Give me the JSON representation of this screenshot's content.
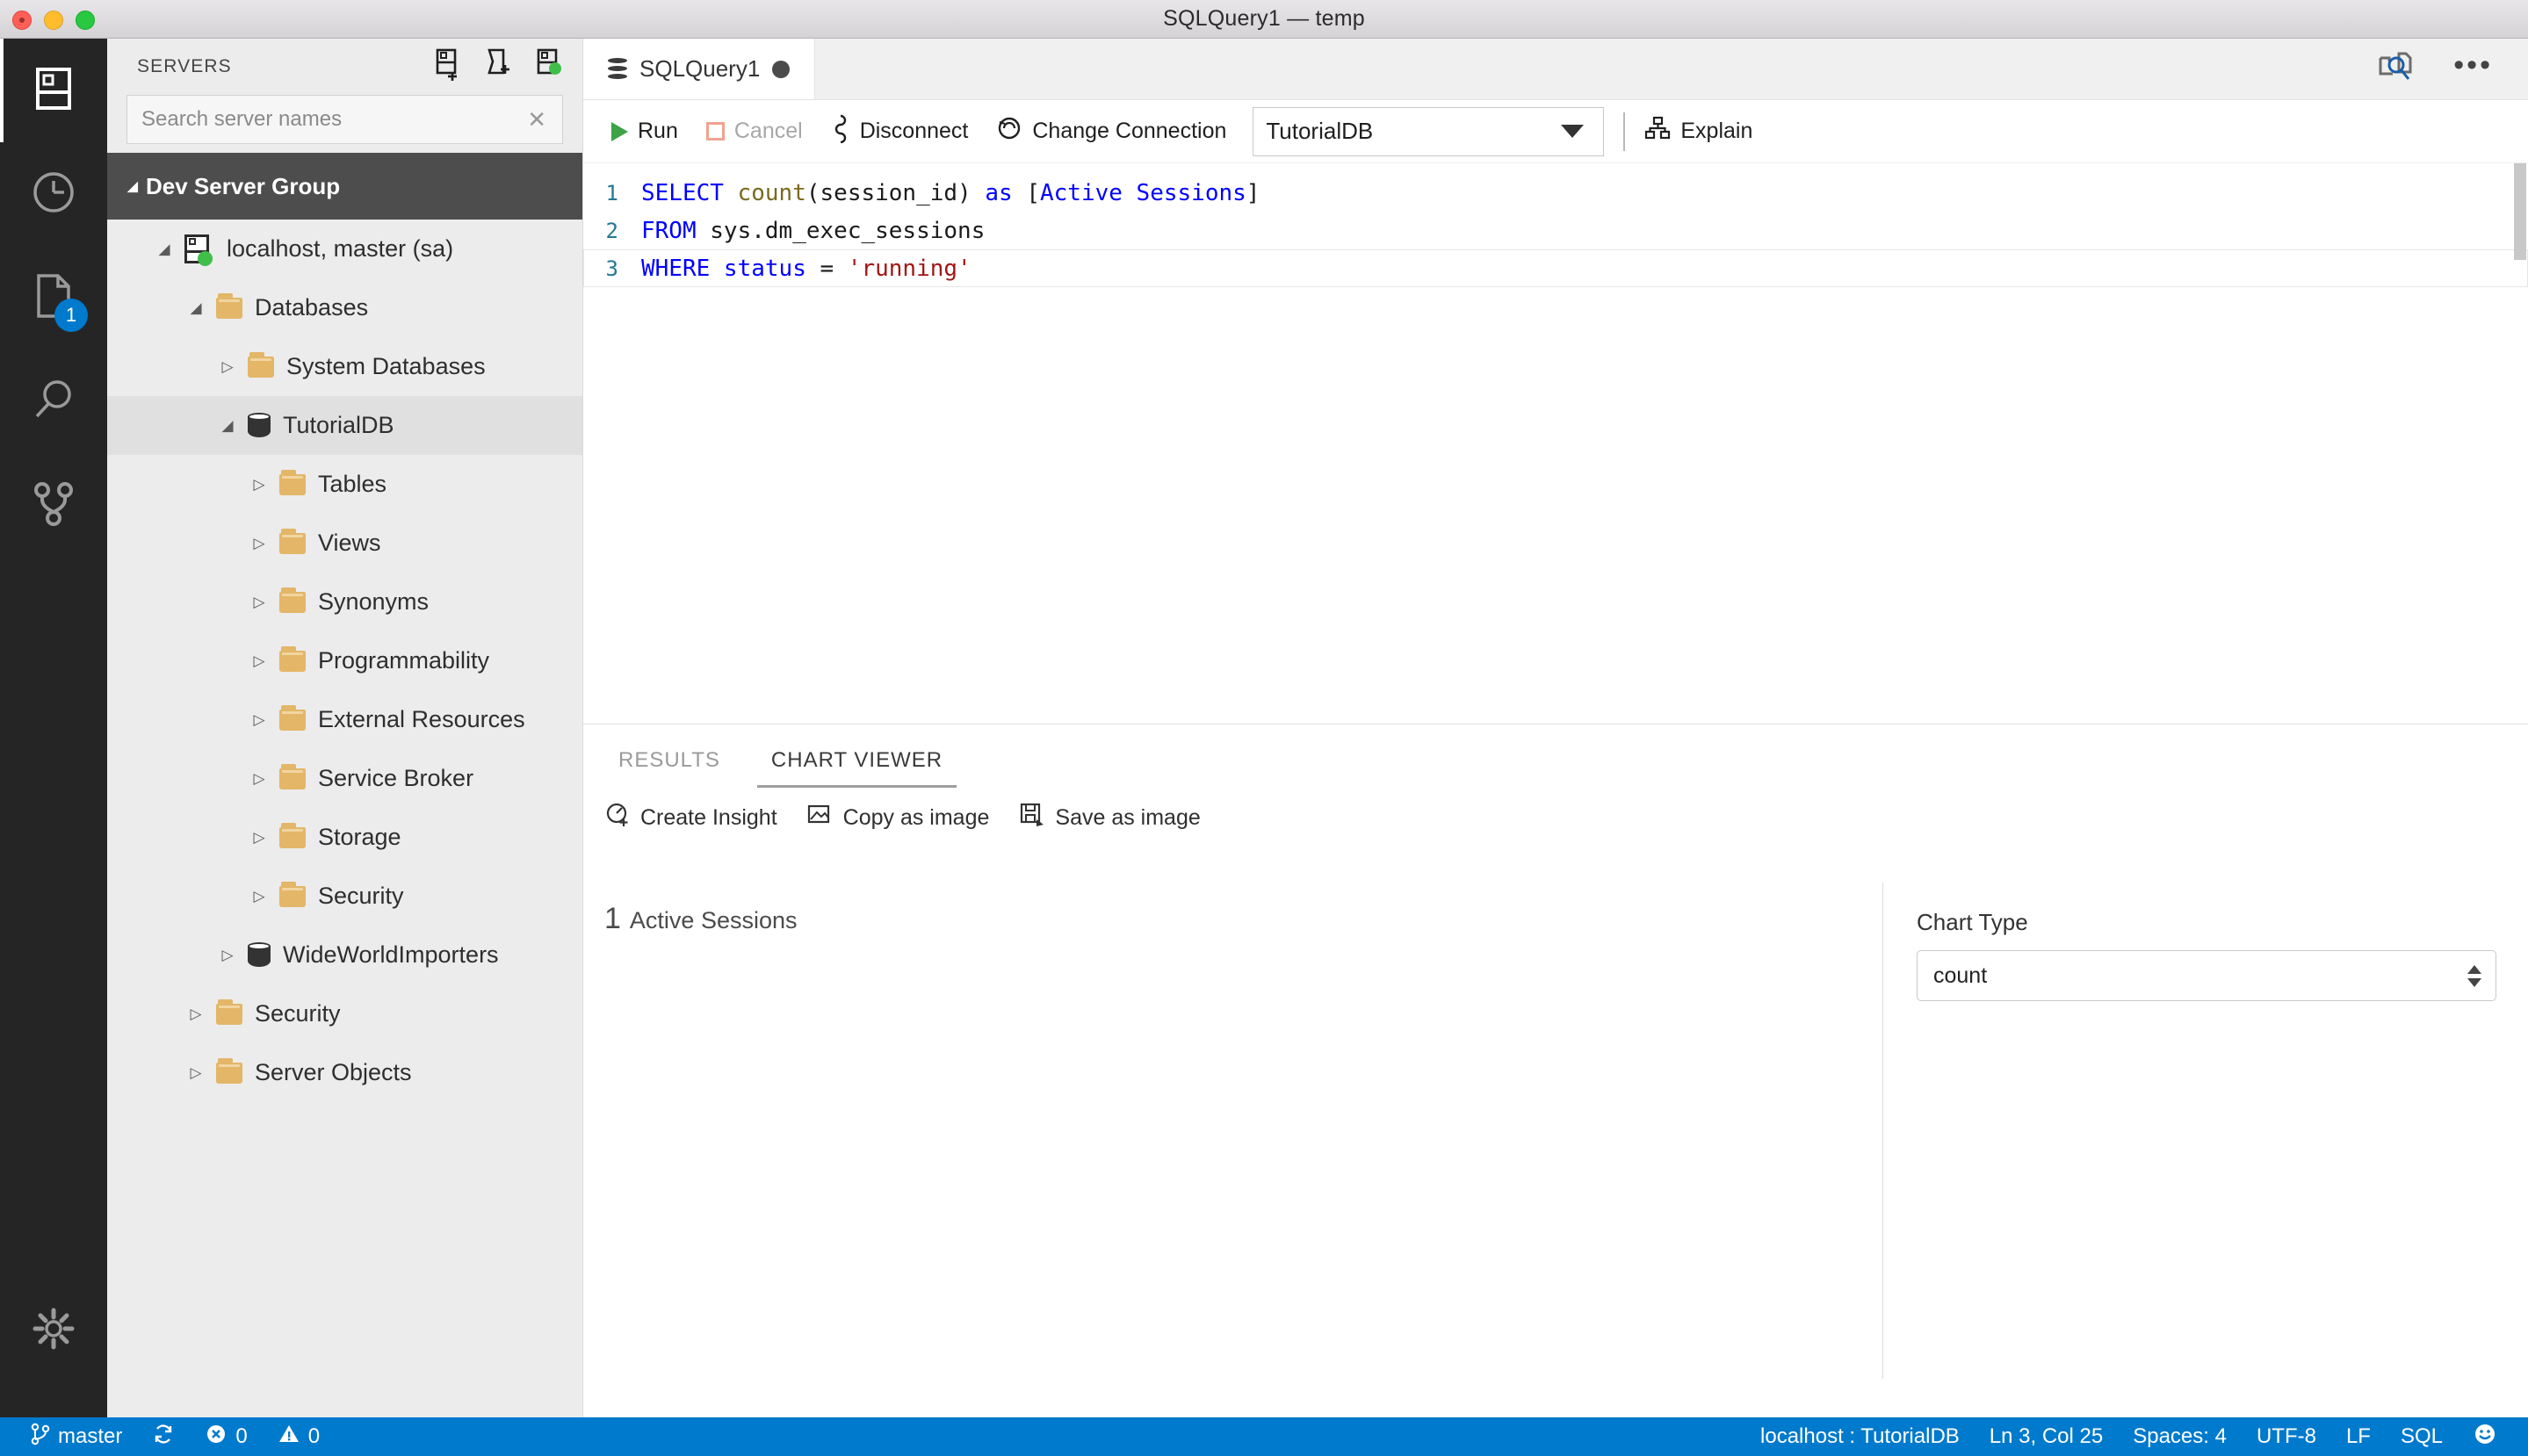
{
  "window": {
    "title": "SQLQuery1 — temp",
    "traffic_lights": [
      "close",
      "minimize",
      "zoom"
    ]
  },
  "activity_bar": {
    "items": [
      {
        "name": "servers-icon",
        "label": "Servers",
        "active": true,
        "badge": null
      },
      {
        "name": "history-icon",
        "label": "History",
        "active": false,
        "badge": null
      },
      {
        "name": "tasks-icon",
        "label": "Tasks",
        "active": false,
        "badge": "1"
      },
      {
        "name": "search-icon",
        "label": "Search",
        "active": false,
        "badge": null
      },
      {
        "name": "source-control-icon",
        "label": "Source Control",
        "active": false,
        "badge": null
      }
    ],
    "bottom": {
      "name": "gear-icon",
      "label": "Manage"
    }
  },
  "sidebar": {
    "title": "SERVERS",
    "actions": [
      {
        "name": "new-connection-icon",
        "label": "New Connection"
      },
      {
        "name": "new-server-group-icon",
        "label": "New Server Group"
      },
      {
        "name": "active-connections-icon",
        "label": "Show Active Connections"
      }
    ],
    "search": {
      "placeholder": "Search server names",
      "value": "",
      "clear_label": "✕"
    },
    "tree": [
      {
        "label": "Dev Server Group",
        "icon": "none",
        "indent": 0,
        "twisty": "expanded",
        "kind": "group",
        "selected": false
      },
      {
        "label": "localhost, master (sa)",
        "icon": "server",
        "indent": 1,
        "twisty": "expanded",
        "kind": "server",
        "selected": false
      },
      {
        "label": "Databases",
        "icon": "folder",
        "indent": 2,
        "twisty": "expanded",
        "kind": "folder",
        "selected": false
      },
      {
        "label": "System Databases",
        "icon": "folder",
        "indent": 3,
        "twisty": "collapsed",
        "kind": "folder",
        "selected": false
      },
      {
        "label": "TutorialDB",
        "icon": "database",
        "indent": 3,
        "twisty": "expanded",
        "kind": "database",
        "selected": true
      },
      {
        "label": "Tables",
        "icon": "folder",
        "indent": 4,
        "twisty": "collapsed",
        "kind": "folder",
        "selected": false
      },
      {
        "label": "Views",
        "icon": "folder",
        "indent": 4,
        "twisty": "collapsed",
        "kind": "folder",
        "selected": false
      },
      {
        "label": "Synonyms",
        "icon": "folder",
        "indent": 4,
        "twisty": "collapsed",
        "kind": "folder",
        "selected": false
      },
      {
        "label": "Programmability",
        "icon": "folder",
        "indent": 4,
        "twisty": "collapsed",
        "kind": "folder",
        "selected": false
      },
      {
        "label": "External Resources",
        "icon": "folder",
        "indent": 4,
        "twisty": "collapsed",
        "kind": "folder",
        "selected": false
      },
      {
        "label": "Service Broker",
        "icon": "folder",
        "indent": 4,
        "twisty": "collapsed",
        "kind": "folder",
        "selected": false
      },
      {
        "label": "Storage",
        "icon": "folder",
        "indent": 4,
        "twisty": "collapsed",
        "kind": "folder",
        "selected": false
      },
      {
        "label": "Security",
        "icon": "folder",
        "indent": 4,
        "twisty": "collapsed",
        "kind": "folder",
        "selected": false
      },
      {
        "label": "WideWorldImporters",
        "icon": "database",
        "indent": 3,
        "twisty": "collapsed",
        "kind": "database",
        "selected": false
      },
      {
        "label": "Security",
        "icon": "folder",
        "indent": 2,
        "twisty": "collapsed",
        "kind": "folder",
        "selected": false
      },
      {
        "label": "Server Objects",
        "icon": "folder",
        "indent": 2,
        "twisty": "collapsed",
        "kind": "folder",
        "selected": false
      }
    ]
  },
  "editor": {
    "tab": {
      "label": "SQLQuery1",
      "icon": "database-icon",
      "dirty": true
    },
    "tab_actions": [
      {
        "name": "compare-icon",
        "label": "Compare"
      },
      {
        "name": "more-actions-icon",
        "label": "•••"
      }
    ],
    "toolbar": {
      "run_label": "Run",
      "cancel_label": "Cancel",
      "cancel_disabled": true,
      "disconnect_label": "Disconnect",
      "change_connection_label": "Change Connection",
      "database_value": "TutorialDB",
      "explain_label": "Explain"
    },
    "code_lines": [
      {
        "n": "1",
        "tokens": [
          {
            "t": "SELECT ",
            "c": "kw"
          },
          {
            "t": "count",
            "c": "fn"
          },
          {
            "t": "(session_id) ",
            "c": "plain"
          },
          {
            "t": "as ",
            "c": "kw"
          },
          {
            "t": "[",
            "c": "plain"
          },
          {
            "t": "Active Sessions",
            "c": "kw"
          },
          {
            "t": "]",
            "c": "plain"
          }
        ]
      },
      {
        "n": "2",
        "tokens": [
          {
            "t": "FROM ",
            "c": "kw"
          },
          {
            "t": "sys.dm_exec_sessions",
            "c": "plain"
          }
        ]
      },
      {
        "n": "3",
        "current": true,
        "tokens": [
          {
            "t": "WHERE ",
            "c": "kw"
          },
          {
            "t": "status ",
            "c": "kw"
          },
          {
            "t": "= ",
            "c": "plain"
          },
          {
            "t": "'running'",
            "c": "str"
          }
        ]
      }
    ]
  },
  "results": {
    "tabs": [
      {
        "label": "RESULTS",
        "active": false
      },
      {
        "label": "CHART VIEWER",
        "active": true
      }
    ],
    "actions": [
      {
        "name": "create-insight-icon",
        "label": "Create Insight"
      },
      {
        "name": "copy-as-image-icon",
        "label": "Copy as image"
      },
      {
        "name": "save-as-image-icon",
        "label": "Save as image"
      }
    ],
    "chart_config": {
      "label": "Chart Type",
      "selected": "count"
    }
  },
  "chart_data": {
    "type": "table",
    "title": "Active Sessions",
    "categories": [
      "Active Sessions"
    ],
    "values": [
      1
    ],
    "display_number": "1",
    "display_label": "Active Sessions",
    "xlabel": "",
    "ylabel": "",
    "legend": "none",
    "grid": false
  },
  "status_bar": {
    "left": [
      {
        "name": "branch",
        "icon": "source-control-icon",
        "label": "master"
      },
      {
        "name": "sync",
        "icon": "sync-icon",
        "label": ""
      },
      {
        "name": "errors",
        "icon": "error-icon",
        "label": "0"
      },
      {
        "name": "warnings",
        "icon": "warning-icon",
        "label": "0"
      }
    ],
    "right": [
      {
        "name": "connection",
        "label": "localhost : TutorialDB"
      },
      {
        "name": "cursor-position",
        "label": "Ln 3, Col 25"
      },
      {
        "name": "indentation",
        "label": "Spaces: 4"
      },
      {
        "name": "encoding",
        "label": "UTF-8"
      },
      {
        "name": "eol",
        "label": "LF"
      },
      {
        "name": "language-mode",
        "label": "SQL"
      },
      {
        "name": "feedback",
        "label": "☺"
      }
    ]
  },
  "colors": {
    "accent": "#007acc",
    "status_green": "#3fbf4a",
    "folder": "#e3b668",
    "keyword": "#0000ff",
    "string": "#a31515",
    "activity_bar_bg": "#252526",
    "sidebar_bg": "#ececec"
  }
}
